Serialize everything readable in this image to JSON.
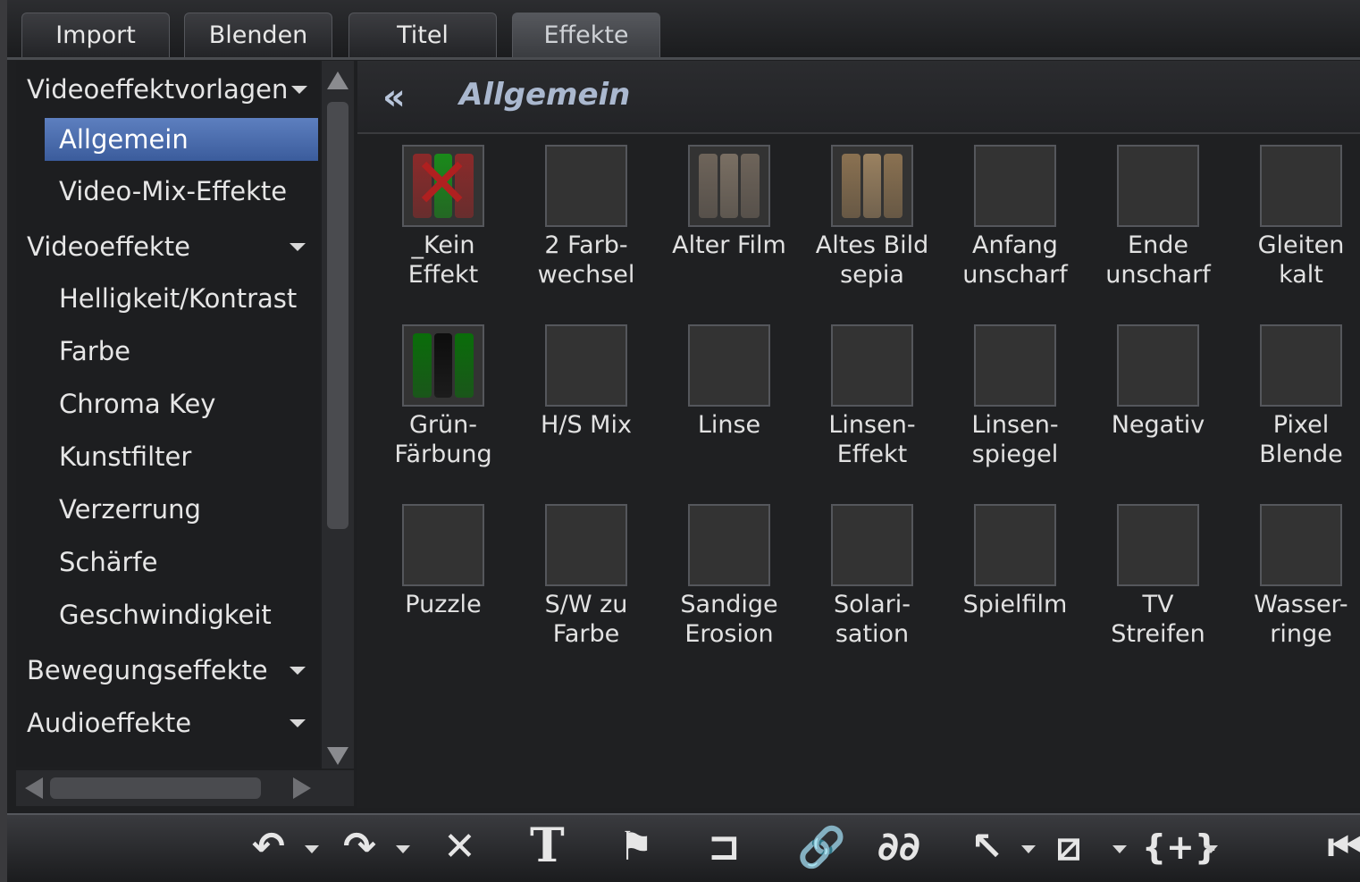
{
  "tabs": [
    {
      "label": "Import"
    },
    {
      "label": "Blenden"
    },
    {
      "label": "Titel"
    },
    {
      "label": "Effekte",
      "active": true
    }
  ],
  "sidebar": {
    "items": [
      {
        "label": "Videoeffektvorlagen",
        "kind": "category",
        "expanded": true
      },
      {
        "label": "Allgemein",
        "kind": "sub",
        "selected": true
      },
      {
        "label": "Video-Mix-Effekte",
        "kind": "sub"
      },
      {
        "label": "Videoeffekte",
        "kind": "category",
        "expanded": true
      },
      {
        "label": "Helligkeit/Kontrast",
        "kind": "sub"
      },
      {
        "label": "Farbe",
        "kind": "sub"
      },
      {
        "label": "Chroma Key",
        "kind": "sub"
      },
      {
        "label": "Kunstfilter",
        "kind": "sub"
      },
      {
        "label": "Verzerrung",
        "kind": "sub"
      },
      {
        "label": "Schärfe",
        "kind": "sub"
      },
      {
        "label": "Geschwindigkeit",
        "kind": "sub"
      },
      {
        "label": "Bewegungseffekte",
        "kind": "category"
      },
      {
        "label": "Audioeffekte",
        "kind": "category"
      }
    ]
  },
  "main": {
    "title": "Allgemein",
    "back_icon": "double-chevron-left-icon",
    "effects": [
      {
        "label": "_Kein\nEffekt",
        "icon": "no-effect-icon"
      },
      {
        "label": "2 Farb-\nwechsel",
        "icon": "color-swap-icon"
      },
      {
        "label": "Alter Film",
        "icon": "old-film-icon"
      },
      {
        "label": "Altes Bild\nsepia",
        "icon": "sepia-icon"
      },
      {
        "label": "Anfang\nunscharf",
        "icon": "blur-start-icon"
      },
      {
        "label": "Ende\nunscharf",
        "icon": "blur-end-icon"
      },
      {
        "label": "Gleiten\nkalt",
        "icon": "glide-cold-icon"
      },
      {
        "label": "Grün-\nFärbung",
        "icon": "green-tint-icon"
      },
      {
        "label": "H/S Mix",
        "icon": "hs-mix-icon"
      },
      {
        "label": "Linse",
        "icon": "lens-icon"
      },
      {
        "label": "Linsen-\nEffekt",
        "icon": "lens-effect-icon"
      },
      {
        "label": "Linsen-\nspiegel",
        "icon": "lens-mirror-icon"
      },
      {
        "label": "Negativ",
        "icon": "negative-icon"
      },
      {
        "label": "Pixel\nBlende",
        "icon": "pixel-blend-icon"
      },
      {
        "label": "Puzzle",
        "icon": "puzzle-icon"
      },
      {
        "label": "S/W zu\nFarbe",
        "icon": "bw-to-color-icon"
      },
      {
        "label": "Sandige\nErosion",
        "icon": "sand-erosion-icon"
      },
      {
        "label": "Solari-\nsation",
        "icon": "solarisation-icon"
      },
      {
        "label": "Spielfilm",
        "icon": "feature-film-icon"
      },
      {
        "label": "TV\nStreifen",
        "icon": "tv-stripes-icon"
      },
      {
        "label": "Wasser-\nringe",
        "icon": "water-rings-icon"
      }
    ]
  },
  "toolbar": {
    "buttons": [
      {
        "icon": "undo-icon",
        "dropdown": true
      },
      {
        "icon": "redo-icon",
        "dropdown": true
      },
      {
        "icon": "delete-icon"
      },
      {
        "icon": "title-text-icon"
      },
      {
        "icon": "marker-icon"
      },
      {
        "icon": "group-icon"
      },
      {
        "icon": "link-icon"
      },
      {
        "icon": "unlink-icon"
      },
      {
        "icon": "mouse-mode-icon",
        "dropdown": true
      },
      {
        "icon": "razor-icon",
        "dropdown": true
      },
      {
        "icon": "insert-mode-icon",
        "dropdown": true
      },
      {
        "icon": "skip-to-start-icon"
      }
    ]
  }
}
